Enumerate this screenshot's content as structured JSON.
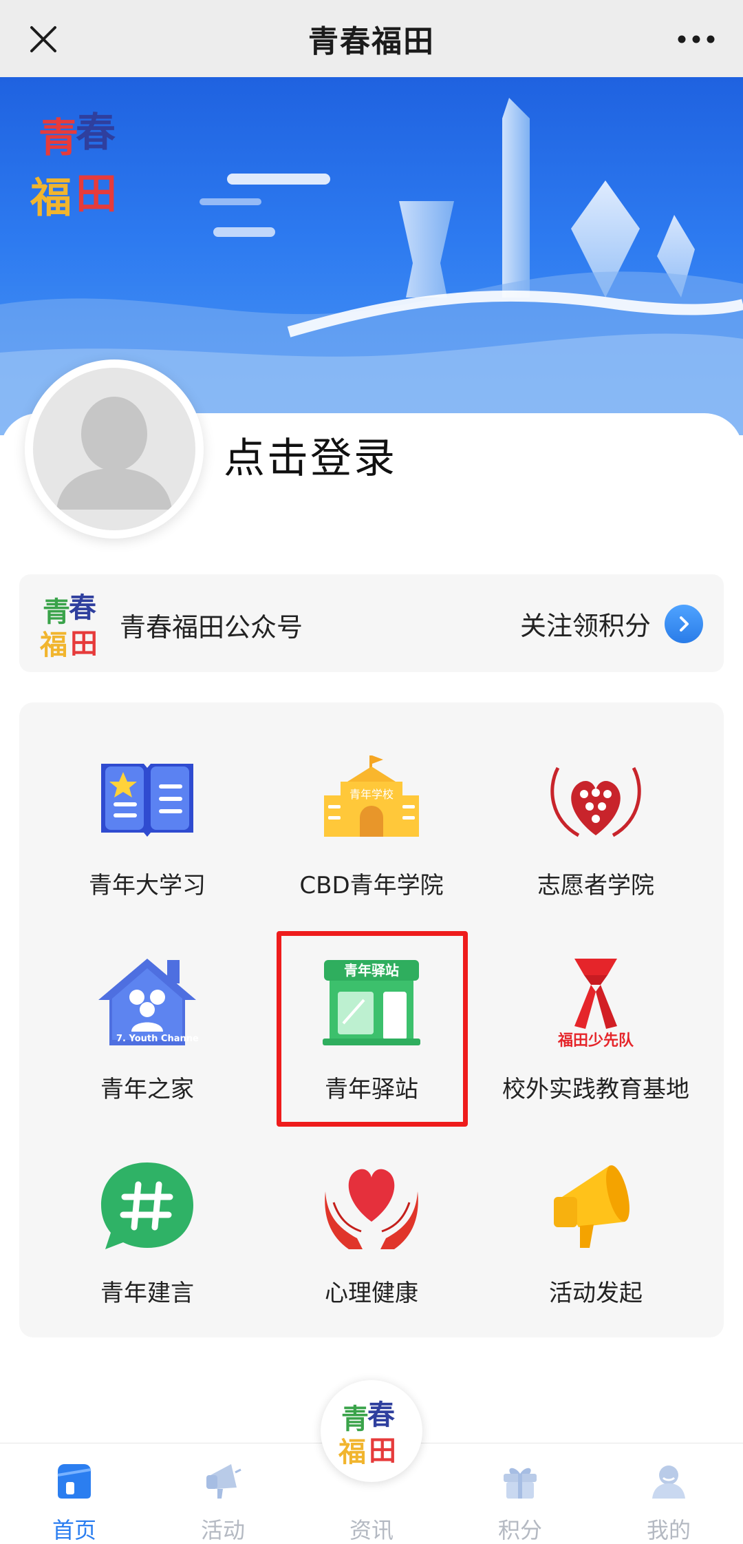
{
  "topbar": {
    "title": "青春福田",
    "close_icon": "close-icon",
    "more_icon": "more-icon"
  },
  "banner": {
    "logo_text": [
      "青春",
      "福田"
    ],
    "theme_color": "#2d7af0"
  },
  "profile": {
    "login_label": "点击登录"
  },
  "account": {
    "name": "青春福田公众号",
    "follow_label": "关注领积分",
    "arrow_color": "#2a7ce8"
  },
  "grid": {
    "items": [
      {
        "label": "青年大学习",
        "icon": "book-icon"
      },
      {
        "label": "CBD青年学院",
        "icon": "school-icon"
      },
      {
        "label": "志愿者学院",
        "icon": "volunteer-icon"
      },
      {
        "label": "青年之家",
        "icon": "house-icon"
      },
      {
        "label": "青年驿站",
        "icon": "station-icon",
        "highlighted": true
      },
      {
        "label": "校外实践教育基地",
        "icon": "scarf-icon"
      },
      {
        "label": "青年建言",
        "icon": "hashtag-icon"
      },
      {
        "label": "心理健康",
        "icon": "heart-hands-icon"
      },
      {
        "label": "活动发起",
        "icon": "megaphone-icon"
      }
    ],
    "station_sign": "青年驿站",
    "scarf_caption": "福田少先队",
    "house_caption": "7. Youth Channe",
    "school_sign": "青年学校"
  },
  "tabbar": {
    "tabs": [
      {
        "label": "首页",
        "icon": "home-icon",
        "active": true
      },
      {
        "label": "活动",
        "icon": "megaphone-icon",
        "active": false
      },
      {
        "label": "资讯",
        "icon": "logo-icon",
        "active": false
      },
      {
        "label": "积分",
        "icon": "gift-icon",
        "active": false
      },
      {
        "label": "我的",
        "icon": "user-icon",
        "active": false
      }
    ],
    "active_color": "#2b7ef0",
    "inactive_color": "#b4b9c2"
  }
}
